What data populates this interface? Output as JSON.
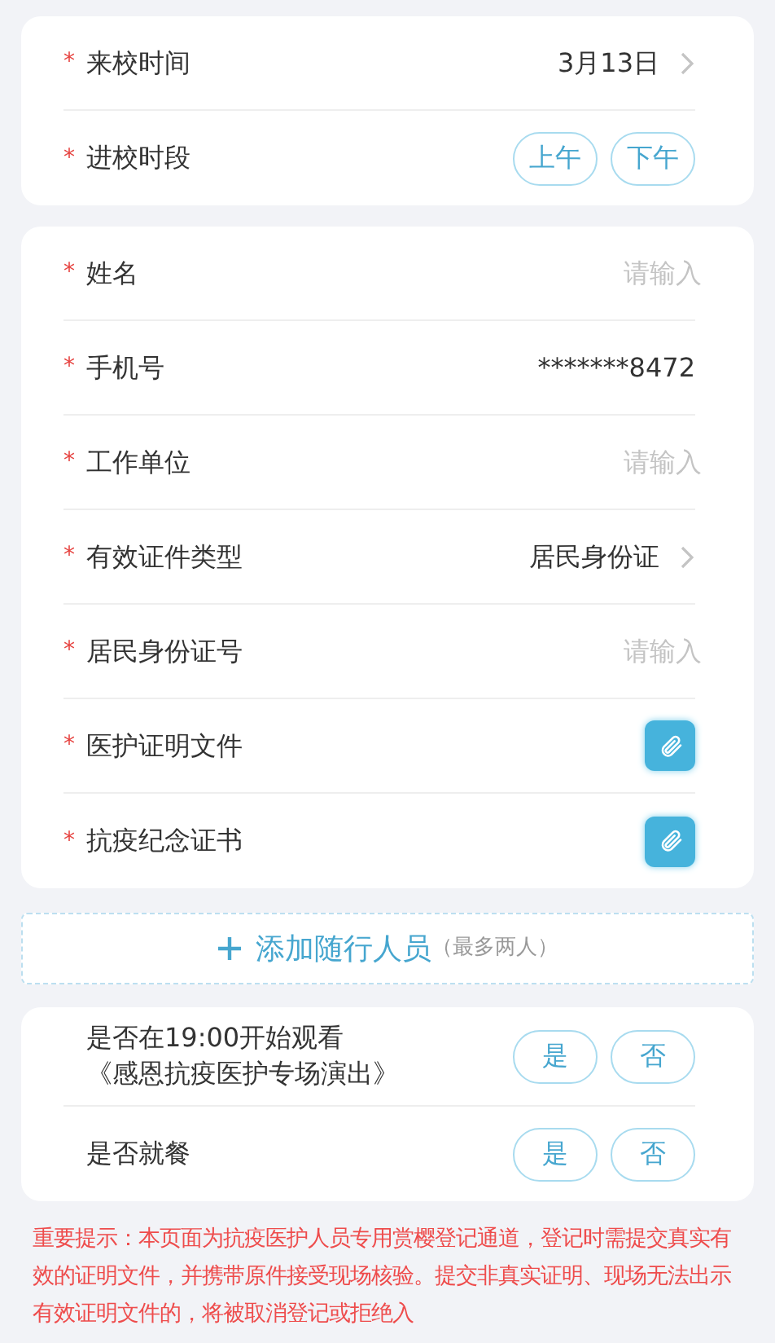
{
  "visit_card": [
    {
      "kind": "select",
      "mark": "*",
      "label": "来校时间",
      "value": "3月13日"
    },
    {
      "kind": "choice",
      "mark": "*",
      "label": "进校时段",
      "options": [
        {
          "label": "上午",
          "selected": false
        },
        {
          "label": "下午",
          "selected": false
        }
      ]
    }
  ],
  "person_card": [
    {
      "kind": "input",
      "mark": "*",
      "label": "姓名",
      "placeholder": "请输入"
    },
    {
      "kind": "value",
      "mark": "*",
      "label": "手机号",
      "value": "*******8472"
    },
    {
      "kind": "input",
      "mark": "*",
      "label": "工作单位",
      "placeholder": "请输入"
    },
    {
      "kind": "select",
      "mark": "*",
      "label": "有效证件类型",
      "value": "居民身份证"
    },
    {
      "kind": "input",
      "mark": "*",
      "label": "居民身份证号",
      "placeholder": "请输入"
    },
    {
      "kind": "upload",
      "mark": "*",
      "label": "医护证明文件"
    },
    {
      "kind": "upload",
      "mark": "*",
      "label": "抗疫纪念证书"
    }
  ],
  "add_companion": {
    "label": "添加随行人员",
    "note": "（最多两人）"
  },
  "questions_card": [
    {
      "kind": "choice",
      "label": "是否在19:00开始观看",
      "sublabel": "《感恩抗疫医护专场演出》",
      "options": [
        {
          "label": "是",
          "selected": false
        },
        {
          "label": "否",
          "selected": false
        }
      ]
    },
    {
      "kind": "choice",
      "label": "是否就餐",
      "options": [
        {
          "label": "是",
          "selected": false
        },
        {
          "label": "否",
          "selected": false
        }
      ]
    }
  ],
  "notice": "重要提示：本页面为抗疫医护人员专用赏樱登记通道，登记时需提交真实有效的证明文件，并携带原件接受现场核验。提交非真实证明、现场无法出示有效证明文件的，将被取消登记或拒绝入"
}
